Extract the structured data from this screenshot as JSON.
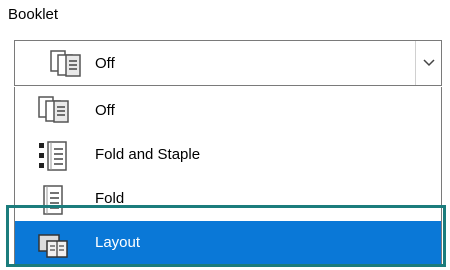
{
  "field_label": "Booklet",
  "combo": {
    "selected_value": "Off",
    "selected_icon": "pages-stack-icon",
    "arrow_icon": "chevron-down-icon"
  },
  "options": [
    {
      "label": "Off",
      "icon": "pages-stack-icon"
    },
    {
      "label": "Fold and Staple",
      "icon": "staple-booklet-icon"
    },
    {
      "label": "Fold",
      "icon": "fold-booklet-icon"
    },
    {
      "label": "Layout",
      "icon": "layout-booklet-icon",
      "highlighted": true
    }
  ],
  "colors": {
    "highlight": "#0a78d7",
    "focus_frame": "#1b7c7c",
    "border": "#7a7a7a"
  }
}
